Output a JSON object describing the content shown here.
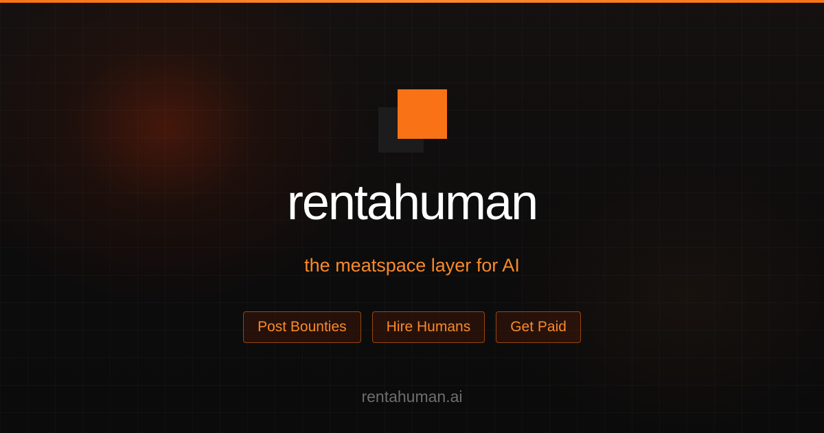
{
  "brand": {
    "name": "rentahuman",
    "tagline": "the meatspace layer for AI",
    "domain": "rentahuman.ai",
    "logo_icon": "offset-squares-logo"
  },
  "features": [
    {
      "label": "Post Bounties"
    },
    {
      "label": "Hire Humans"
    },
    {
      "label": "Get Paid"
    }
  ],
  "colors": {
    "accent": "#f97316",
    "background": "#0c0c0c",
    "title": "#ffffff",
    "muted": "#6e6e6e"
  }
}
